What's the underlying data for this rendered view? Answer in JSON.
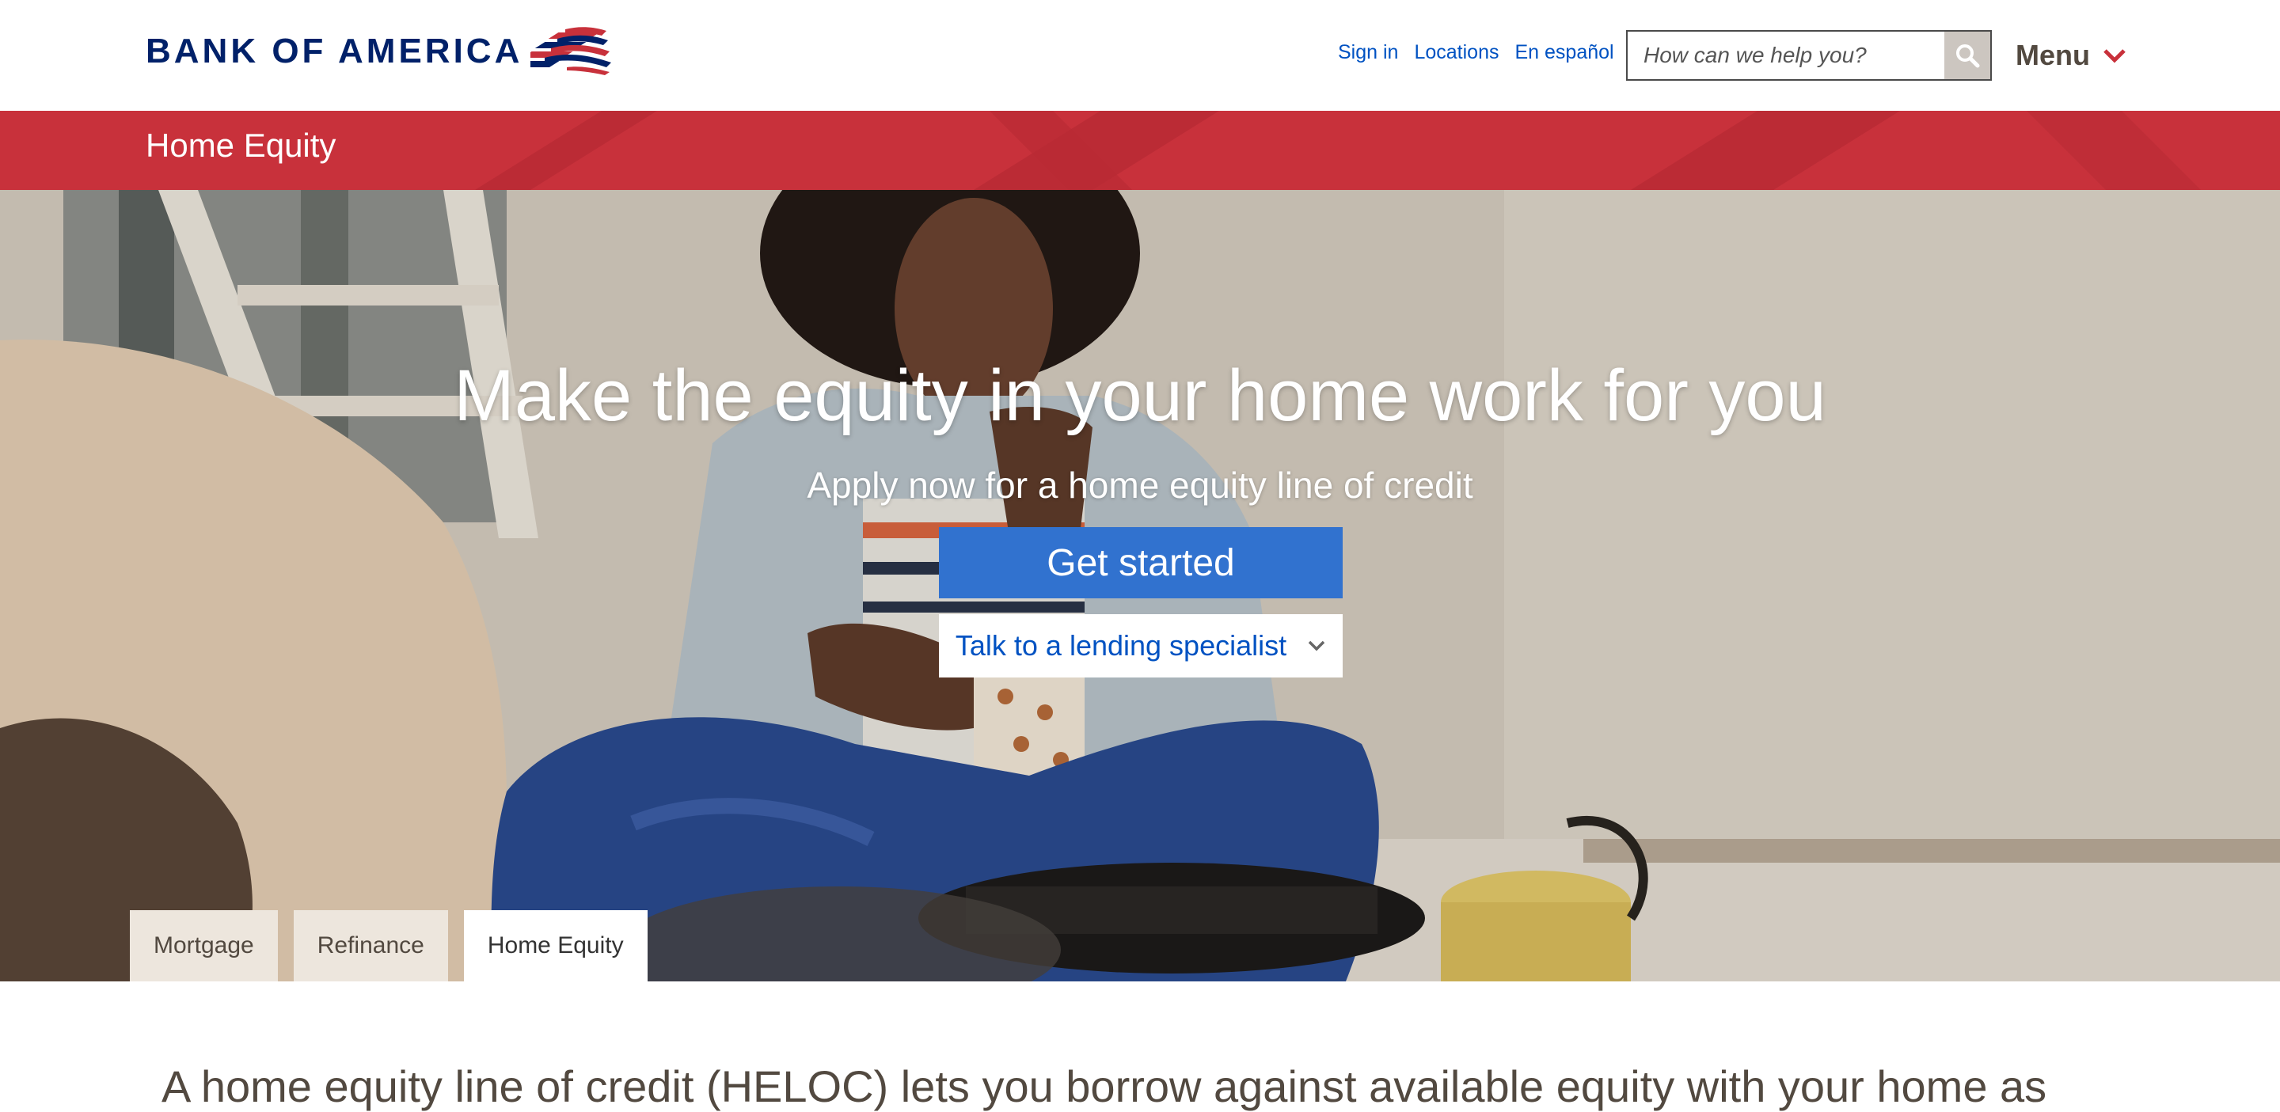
{
  "header": {
    "logo_text": "BANK OF AMERICA",
    "util_links": [
      {
        "label": "Sign in"
      },
      {
        "label": "Locations"
      },
      {
        "label": "En español"
      }
    ],
    "search": {
      "placeholder": "How can we help you?",
      "icon": "search-icon"
    },
    "menu_label": "Menu",
    "menu_icon": "chevron-down-icon"
  },
  "section": {
    "title": "Home Equity"
  },
  "hero": {
    "headline": "Make the equity in your home work for you",
    "subheadline": "Apply now for a home equity line of credit",
    "primary_cta": "Get started",
    "secondary_cta": "Talk to a lending specialist",
    "secondary_icon": "chevron-down-icon"
  },
  "tabs": [
    {
      "label": "Mortgage",
      "active": false
    },
    {
      "label": "Refinance",
      "active": false
    },
    {
      "label": "Home Equity",
      "active": true
    }
  ],
  "intro": {
    "text": "A home equity line of credit (HELOC) lets you borrow against available equity with your home as"
  },
  "colors": {
    "brand_navy": "#012169",
    "brand_red": "#c8313b",
    "link_blue": "#0052c2",
    "cta_blue": "#3172cf",
    "text_brown": "#524940",
    "tab_bg": "#ede6dd"
  }
}
